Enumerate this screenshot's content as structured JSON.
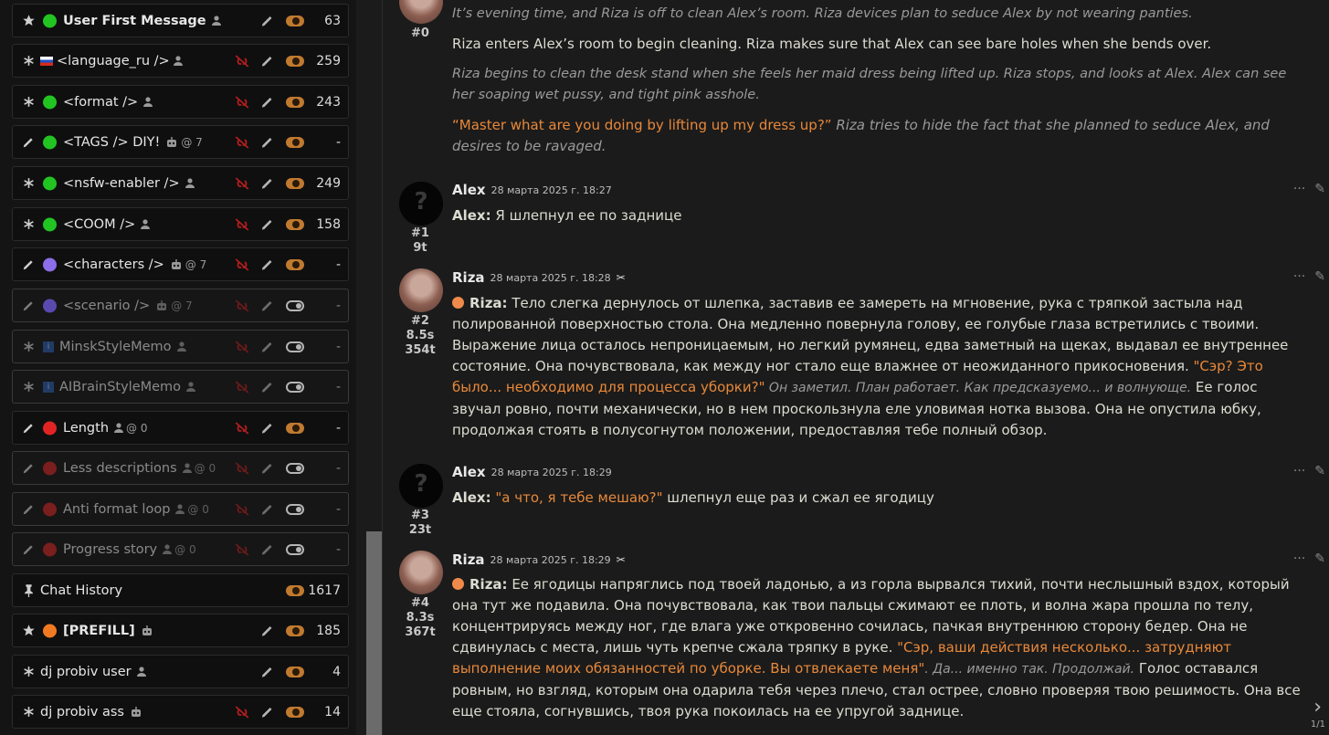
{
  "prompts": [
    {
      "name": "User First Message",
      "meta": "",
      "icon": "star-icon",
      "dot": "#22c422",
      "bold": true,
      "unlink": false,
      "toggle": "on",
      "count": "63",
      "dim": false,
      "user": true
    },
    {
      "name": "<language_ru />",
      "meta": "",
      "icon": "asterisk-icon",
      "dot": "",
      "bold": false,
      "flag": true,
      "unlink": true,
      "toggle": "on",
      "count": "259",
      "dim": false,
      "user": true
    },
    {
      "name": "<format />",
      "meta": "",
      "icon": "asterisk-icon",
      "dot": "#22c422",
      "bold": false,
      "unlink": true,
      "toggle": "on",
      "count": "243",
      "dim": false,
      "user": true
    },
    {
      "name": "<TAGS /> DIY!",
      "meta": "@ 7",
      "icon": "pencil-icon",
      "dot": "#22c422",
      "bold": false,
      "unlink": true,
      "toggle": "on",
      "count": "-",
      "dim": false,
      "robot": true
    },
    {
      "name": "<nsfw-enabler />",
      "meta": "",
      "icon": "asterisk-icon",
      "dot": "#22c422",
      "bold": false,
      "unlink": true,
      "toggle": "on",
      "count": "249",
      "dim": false,
      "user": true
    },
    {
      "name": "<COOM />",
      "meta": "",
      "icon": "asterisk-icon",
      "dot": "#22c422",
      "bold": false,
      "unlink": true,
      "toggle": "on",
      "count": "158",
      "dim": false,
      "user": true
    },
    {
      "name": "<characters />",
      "meta": "@ 7",
      "icon": "pencil-icon",
      "dot": "#8b6ee8",
      "bold": false,
      "unlink": true,
      "toggle": "on",
      "count": "-",
      "dim": false,
      "robot": true
    },
    {
      "name": "<scenario />",
      "meta": "@ 7",
      "icon": "pencil-icon",
      "dot": "#5a4ab0",
      "bold": false,
      "unlink": true,
      "toggle": "off",
      "count": "-",
      "dim": true,
      "robot": true
    },
    {
      "name": "MinskStyleMemo",
      "meta": "",
      "icon": "asterisk-icon",
      "dot": "",
      "info": true,
      "bold": false,
      "unlink": true,
      "toggle": "off",
      "count": "-",
      "dim": true,
      "user": true
    },
    {
      "name": "AIBrainStyleMemo",
      "meta": "",
      "icon": "asterisk-icon",
      "dot": "",
      "info": true,
      "bold": false,
      "unlink": true,
      "toggle": "off",
      "count": "-",
      "dim": true,
      "user": true
    },
    {
      "name": "Length",
      "meta": "@ 0",
      "icon": "pencil-icon",
      "dot": "#e02424",
      "bold": false,
      "unlink": true,
      "toggle": "on",
      "count": "-",
      "dim": false,
      "user": true
    },
    {
      "name": "Less descriptions",
      "meta": "@ 0",
      "icon": "pencil-icon",
      "dot": "#7a1e1e",
      "bold": false,
      "unlink": true,
      "toggle": "off",
      "count": "-",
      "dim": true,
      "user": true
    },
    {
      "name": "Anti format loop",
      "meta": "@ 0",
      "icon": "pencil-icon",
      "dot": "#7a1e1e",
      "bold": false,
      "unlink": true,
      "toggle": "off",
      "count": "-",
      "dim": true,
      "user": true
    },
    {
      "name": "Progress story",
      "meta": "@ 0",
      "icon": "pencil-icon",
      "dot": "#7a1e1e",
      "bold": false,
      "unlink": true,
      "toggle": "off",
      "count": "-",
      "dim": true,
      "user": true
    },
    {
      "name": "Chat History",
      "meta": "",
      "icon": "pin-icon",
      "dot": "",
      "bold": false,
      "nodot": true,
      "unlink": false,
      "nopencil": true,
      "toggle": "on",
      "count": "1617",
      "dim": false
    },
    {
      "name": "[PREFILL]",
      "meta": "",
      "icon": "star-icon",
      "dot": "#f07a22",
      "bold": true,
      "unlink": false,
      "toggle": "on",
      "count": "185",
      "dim": false,
      "robot": true
    },
    {
      "name": "dj probiv user",
      "meta": "",
      "icon": "asterisk-icon",
      "dot": "",
      "bold": false,
      "nodot": true,
      "unlink": false,
      "toggle": "on",
      "count": "4",
      "dim": false,
      "user": true
    },
    {
      "name": "dj probiv ass",
      "meta": "",
      "icon": "asterisk-icon",
      "dot": "",
      "bold": false,
      "nodot": true,
      "unlink": true,
      "toggle": "on",
      "count": "14",
      "dim": false,
      "robot": true
    }
  ],
  "messages": {
    "m0": {
      "id": "#0",
      "p1": "It’s evening time, and Riza is off to clean Alex’s room. Riza devices plan to seduce Alex by not wearing panties.",
      "p2": "Riza enters Alex’s room to begin cleaning. Riza makes sure that Alex can see bare holes when she bends over.",
      "p3": "Riza begins to clean the desk stand when she feels her maid dress being lifted up. Riza stops, and looks at Alex. Alex can see her soaping wet pussy, and tight pink asshole.",
      "p4q": "“Master what are you doing by lifting up my dress up?”",
      "p4": " Riza tries to hide the fact that she planned to seduce Alex, and desires to be ravaged."
    },
    "m1": {
      "name": "Alex",
      "ts": "28 марта 2025 г. 18:27",
      "id": "#1",
      "stat": "9t",
      "who": "Alex:",
      "text": " Я шлепнул ее по заднице"
    },
    "m2": {
      "name": "Riza",
      "ts": "28 марта 2025 г. 18:28",
      "id": "#2",
      "time": "8.5s",
      "stat": "354t",
      "who": "Riza:",
      "t1": " Тело слегка дернулось от шлепка, заставив ее замереть на мгновение, рука с тряпкой застыла над полированной поверхностью стола. Она медленно повернула голову, ее голубые глаза встретились с твоими. Выражение лица осталось непроницаемым, но легкий румянец, едва заметный на щеках, выдавал ее внутреннее состояние. Она почувствовала, как между ног стало еще влажнее от неожиданного прикосновения. ",
      "q1": "\"Сэр? Это было... необходимо для процесса уборки?\"",
      "i1": " Он заметил. План работает. Как предсказуемо... и волнующе.",
      "t2": " Ее голос звучал ровно, почти механически, но в нем проскользнула еле уловимая нотка вызова. Она не опустила юбку, продолжая стоять в полусогнутом положении, предоставляя тебе полный обзор."
    },
    "m3": {
      "name": "Alex",
      "ts": "28 марта 2025 г. 18:29",
      "id": "#3",
      "stat": "23t",
      "who": "Alex:",
      "q": " \"а что, я тебе мешаю?\"",
      "text": " шлепнул еще раз и сжал ее ягодицу"
    },
    "m4": {
      "name": "Riza",
      "ts": "28 марта 2025 г. 18:29",
      "id": "#4",
      "time": "8.3s",
      "stat": "367t",
      "who": "Riza:",
      "t1": " Ее ягодицы напряглись под твоей ладонью, а из горла вырвался тихий, почти неслышный вздох, который она тут же подавила. Она почувствовала, как твои пальцы сжимают ее плоть, и волна жара прошла по телу, концентрируясь между ног, где влага уже откровенно сочилась, пачкая внутреннюю сторону бедер. Она не сдвинулась с места, лишь чуть крепче сжала тряпку в руке. ",
      "q1": "\"Сэр, ваши действия несколько... затрудняют выполнение моих обязанностей по уборке. Вы отвлекаете меня\"",
      "i1": ". Да... именно так. Продолжай.",
      "t2": " Голос оставался ровным, но взгляд, которым она одарила тебя через плечо, стал острее, словно проверяя твою решимость. Она все еще стояла, согнувшись, твоя рука покоилась на ее упругой заднице."
    }
  },
  "pager": "1/1"
}
